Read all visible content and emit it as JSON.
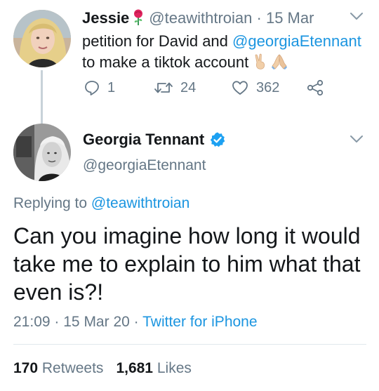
{
  "parent_tweet": {
    "author_name": "Jessie",
    "handle": "@teawithtroian",
    "separator": "·",
    "date": "15 Mar",
    "text_before": "petition for David and ",
    "mention": "@georgiaEtennant",
    "text_after": " to make a tiktok account",
    "reply_count": "1",
    "retweet_count": "24",
    "like_count": "362",
    "name_emoji_icon": "rose-icon",
    "text_emoji_icons": [
      "victory-hand-icon",
      "folded-hands-icon"
    ]
  },
  "main_tweet": {
    "author_name": "Georgia Tennant",
    "handle": "@georgiaEtennant",
    "replying_label": "Replying to ",
    "replying_to": "@teawithtroian",
    "text": "Can you imagine how long it would take me to explain to him what that even is?!",
    "time": "21:09",
    "date": "15 Mar 20",
    "separator": "·",
    "source": "Twitter for iPhone",
    "retweets_count": "170",
    "retweets_label": "Retweets",
    "likes_count": "1,681",
    "likes_label": "Likes"
  },
  "colors": {
    "link": "#1b95e0",
    "muted": "#657786",
    "text": "#14171a",
    "verified": "#1da1f2",
    "thread_line": "#c8d2d9"
  }
}
